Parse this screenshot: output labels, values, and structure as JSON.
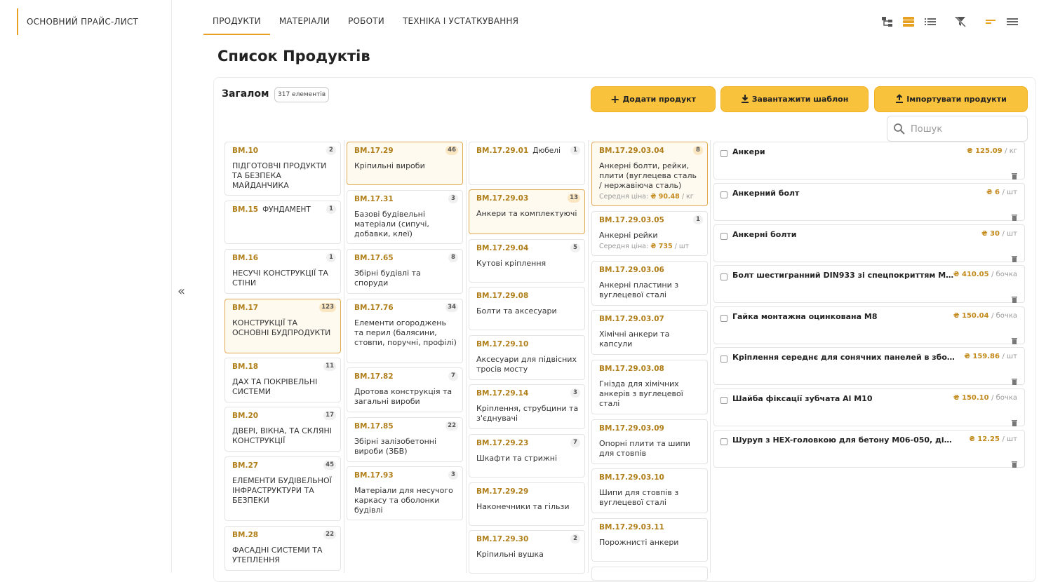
{
  "sidebar": {
    "price_list": "ОСНОВНИЙ ПРАЙС-ЛИСТ"
  },
  "tabs": [
    "ПРОДУКТИ",
    "МАТЕРІАЛИ",
    "РОБОТИ",
    "ТЕХНІКА І УСТАТКУВАННЯ"
  ],
  "page_title": "Список Продуктів",
  "summary": {
    "label": "Загалом",
    "count": "317 елементів"
  },
  "buttons": {
    "add": "Додати продукт",
    "download": "Завантажити шаблон",
    "import": "Імпортувати продукти"
  },
  "search": {
    "placeholder": "Пошук"
  },
  "colors": {
    "accent": "#e8a020",
    "button": "#f9c23c",
    "code": "#b07f1a"
  },
  "col1": [
    {
      "code": "BM.10",
      "count": "2",
      "name": "ПІДГОТОВЧІ ПРОДУКТИ ТА БЕЗПЕКА МАЙДАНЧИКА"
    },
    {
      "code": "BM.15",
      "count": "1",
      "name": "ФУНДАМЕНТ"
    },
    {
      "code": "BM.16",
      "count": "1",
      "name": "НЕСУЧІ КОНСТРУКЦІЇ ТА СТІНИ"
    },
    {
      "code": "BM.17",
      "count": "123",
      "name": "КОНСТРУКЦІЇ ТА ОСНОВНІ БУДПРОДУКТИ"
    },
    {
      "code": "BM.18",
      "count": "11",
      "name": "ДАХ ТА ПОКРІВЕЛЬНІ СИСТЕМИ"
    },
    {
      "code": "BM.20",
      "count": "17",
      "name": "ДВЕРІ, ВІКНА, ТА СКЛЯНІ КОНСТРУКЦІЇ"
    },
    {
      "code": "BM.27",
      "count": "45",
      "name": "ЕЛЕМЕНТИ БУДІВЕЛЬНОЇ ІНФРАСТРУКТУРИ ТА БЕЗПЕКИ"
    },
    {
      "code": "BM.28",
      "count": "22",
      "name": "ФАСАДНІ СИСТЕМИ ТА УТЕПЛЕННЯ"
    }
  ],
  "col2": [
    {
      "code": "BM.17.29",
      "count": "46",
      "name": "Кріпильні вироби"
    },
    {
      "code": "BM.17.31",
      "count": "3",
      "name": "Базові будівельні матеріали (сипучі, добавки, клеї)"
    },
    {
      "code": "BM.17.65",
      "count": "8",
      "name": "Збірні будівлі та споруди"
    },
    {
      "code": "BM.17.76",
      "count": "34",
      "name": "Елементи огороджень та перил (балясини, стовпи, поручні, профілі)"
    },
    {
      "code": "BM.17.82",
      "count": "7",
      "name": "Дротова конструкція та загальні вироби"
    },
    {
      "code": "BM.17.85",
      "count": "22",
      "name": "Збірні залізобетонні вироби (ЗБВ)"
    },
    {
      "code": "BM.17.93",
      "count": "3",
      "name": "Матеріали для несучого каркасу та оболонки будівлі"
    }
  ],
  "col3": [
    {
      "code": "BM.17.29.01",
      "count": "1",
      "name": "Дюбелі"
    },
    {
      "code": "BM.17.29.03",
      "count": "13",
      "name": "Анкери та комплектуючі"
    },
    {
      "code": "BM.17.29.04",
      "count": "5",
      "name": "Кутові кріплення"
    },
    {
      "code": "BM.17.29.08",
      "count": "",
      "name": "Болти та аксесуари"
    },
    {
      "code": "BM.17.29.10",
      "count": "",
      "name": "Аксесуари для підвісних тросів мосту"
    },
    {
      "code": "BM.17.29.14",
      "count": "3",
      "name": "Кріплення, струбцини та з'єднувачі"
    },
    {
      "code": "BM.17.29.23",
      "count": "7",
      "name": "Шкафти та стрижні"
    },
    {
      "code": "BM.17.29.29",
      "count": "",
      "name": "Наконечники та гільзи"
    },
    {
      "code": "BM.17.29.30",
      "count": "2",
      "name": "Кріпильні вушка"
    }
  ],
  "col4": [
    {
      "code": "BM.17.29.03.04",
      "count": "8",
      "name": "Анкерні болти, рейки, плити (вуглецева сталь / нержавіюча сталь)",
      "avg_label": "Середня ціна:",
      "avg_price": "₴ 90.48",
      "avg_unit": "/ кг"
    },
    {
      "code": "BM.17.29.03.05",
      "count": "1",
      "name": "Анкерні рейки",
      "avg_label": "Середня ціна:",
      "avg_price": "₴ 735",
      "avg_unit": "/ шт"
    },
    {
      "code": "BM.17.29.03.06",
      "count": "",
      "name": "Анкерні пластини з вуглецевої сталі"
    },
    {
      "code": "BM.17.29.03.07",
      "count": "",
      "name": "Хімічні анкери та капсули"
    },
    {
      "code": "BM.17.29.03.08",
      "count": "",
      "name": "Гнізда для хімічних анкерів з вуглецевої сталі"
    },
    {
      "code": "BM.17.29.03.09",
      "count": "",
      "name": "Опорні плити та шипи для стовпів"
    },
    {
      "code": "BM.17.29.03.10",
      "count": "",
      "name": "Шипи для стовпів з вуглецевої сталі"
    },
    {
      "code": "BM.17.29.03.11",
      "count": "",
      "name": "Порожнисті анкери"
    }
  ],
  "products": [
    {
      "name": "Анкери",
      "price": "₴ 125.09",
      "unit": "/ кг"
    },
    {
      "name": "Анкерний болт",
      "price": "₴ 6",
      "unit": "/ шт"
    },
    {
      "name": "Анкерні болти",
      "price": "₴ 30",
      "unit": "/ шт"
    },
    {
      "name": "Болт шестигранний DIN933 зі спецпокриттям M8...",
      "price": "₴ 410.05",
      "unit": "/ бочка"
    },
    {
      "name": "Гайка монтажна оцинкована М8",
      "price": "₴ 150.04",
      "unit": "/ бочка"
    },
    {
      "name": "Кріплення середнє для сонячних панелей в зборі (к...",
      "price": "₴ 159.86",
      "unit": "/ шт"
    },
    {
      "name": "Шайба фіксації зубчата Al M10",
      "price": "₴ 150.10",
      "unit": "/ бочка"
    },
    {
      "name": "Шуруп з HEX-головкою для бетону M06-050, діам.7,5, ...",
      "price": "₴ 12.25",
      "unit": "/ шт"
    }
  ]
}
